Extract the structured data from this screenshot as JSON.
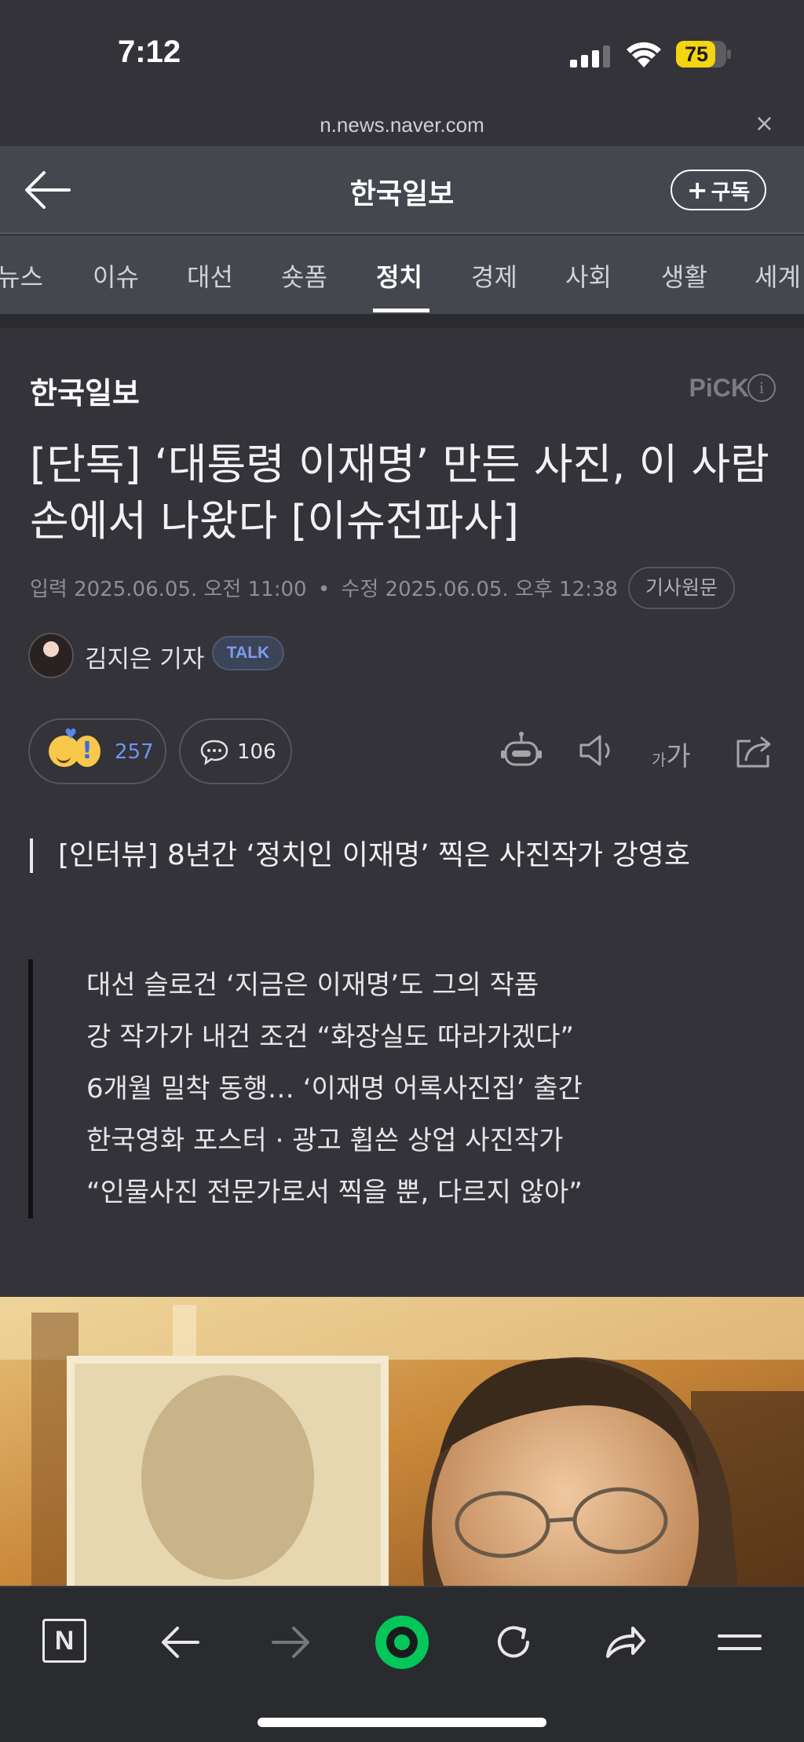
{
  "status_bar": {
    "time": "7:12",
    "battery": "75",
    "url": "n.news.naver.com",
    "close": "×"
  },
  "header": {
    "back_icon": "arrow-left-icon",
    "title": "한국일보",
    "subscribe_label": "구독",
    "subscribe_plus": "+"
  },
  "tabs": [
    {
      "label": "뉴스",
      "active": false
    },
    {
      "label": "이슈",
      "active": false
    },
    {
      "label": "대선",
      "active": false
    },
    {
      "label": "숏폼",
      "active": false
    },
    {
      "label": "정치",
      "active": true
    },
    {
      "label": "경제",
      "active": false
    },
    {
      "label": "사회",
      "active": false
    },
    {
      "label": "생활",
      "active": false
    },
    {
      "label": "세계",
      "active": false
    }
  ],
  "article": {
    "press": "한국일보",
    "pick_label": "PiCK",
    "info_icon": "i",
    "headline": "[단독] ‘대통령 이재명’ 만든 사진, 이 사람 손에서 나왔다 [이슈전파사]",
    "input_label": "입력",
    "input_date": "2025.06.05. 오전 11:00",
    "modified_label": "수정",
    "modified_date": "2025.06.05. 오후 12:38",
    "dot": "•",
    "original_button": "기사원문",
    "author": "김지은 기자",
    "talk_label": "TALK",
    "reaction_count": "257",
    "reaction_exclaim": "!",
    "reaction_heart": "♥",
    "comment_count": "106",
    "font_size_label_small": "가",
    "font_size_label_large": "가",
    "subheadline": "[인터뷰] 8년간 ‘정치인 이재명’ 찍은 사진작가 강영호",
    "summary": [
      "대선 슬로건 ‘지금은 이재명’도 그의 작품",
      "강 작가가 내건 조건 “화장실도 따라가겠다”",
      "6개월 밀착 동행… ‘이재명 어록사진집’ 출간",
      "한국영화 포스터 · 광고 휩쓴 상업 사진작가",
      "“인물사진 전문가로서 찍을 뿐, 다르지 않아”"
    ]
  },
  "bottom_bar": {
    "n_logo": "N",
    "icons": [
      "naver-home-icon",
      "back-arrow-icon",
      "forward-arrow-icon",
      "green-dot-icon",
      "refresh-icon",
      "share-icon",
      "menu-icon"
    ]
  },
  "colors": {
    "background": "#333339",
    "header": "#44474d",
    "accent_blue": "#6f95f2",
    "green_button": "#03c75a"
  }
}
